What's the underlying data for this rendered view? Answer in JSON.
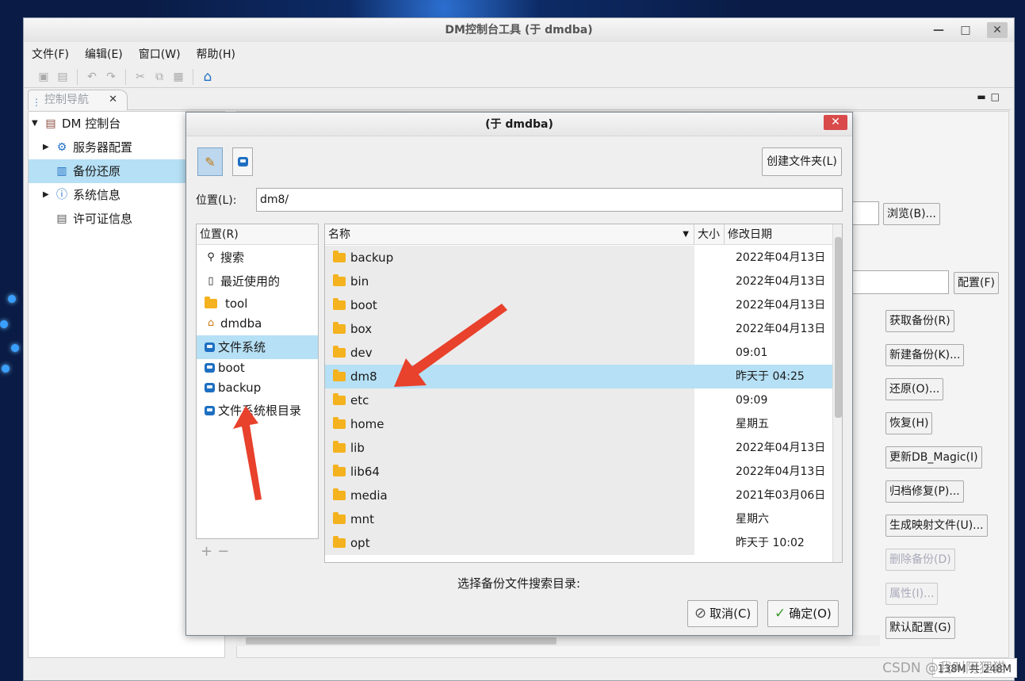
{
  "window": {
    "title": "DM控制台工具 (于 dmdba)",
    "menus": [
      "文件(F)",
      "编辑(E)",
      "窗口(W)",
      "帮助(H)"
    ],
    "tab_label": "控制导航"
  },
  "tree": {
    "root": "DM 控制台",
    "items": [
      "服务器配置",
      "备份还原",
      "系统信息",
      "许可证信息"
    ]
  },
  "right_panel": {
    "browse_btn": "浏览(B)...",
    "config_btn": "配置(F)",
    "buttons": [
      "获取备份(R)",
      "新建备份(K)...",
      "还原(O)...",
      "恢复(H)",
      "更新DB_Magic(I)",
      "归档修复(P)...",
      "生成映射文件(U)...",
      "删除备份(D)",
      "属性(I)...",
      "默认配置(G)"
    ]
  },
  "status": "138M 共 248M",
  "watermark": "CSDN @我叫阿狸猫",
  "dialog": {
    "title": "(于 dmdba)",
    "new_folder": "创建文件夹(L)",
    "location_label": "位置(L):",
    "location_value": "dm8/",
    "places_header": "位置(R)",
    "places": [
      "搜索",
      "最近使用的",
      "tool",
      "dmdba",
      "文件系统",
      "boot",
      "backup",
      "文件系统根目录"
    ],
    "columns": {
      "name": "名称",
      "size": "大小",
      "date": "修改日期"
    },
    "files": [
      {
        "name": "backup",
        "date": "2022年04月13日"
      },
      {
        "name": "bin",
        "date": "2022年04月13日"
      },
      {
        "name": "boot",
        "date": "2022年04月13日"
      },
      {
        "name": "box",
        "date": "2022年04月13日"
      },
      {
        "name": "dev",
        "date": "09:01"
      },
      {
        "name": "dm8",
        "date": "昨天于 04:25"
      },
      {
        "name": "etc",
        "date": "09:09"
      },
      {
        "name": "home",
        "date": "星期五"
      },
      {
        "name": "lib",
        "date": "2022年04月13日"
      },
      {
        "name": "lib64",
        "date": "2022年04月13日"
      },
      {
        "name": "media",
        "date": "2021年03月06日"
      },
      {
        "name": "mnt",
        "date": "星期六"
      },
      {
        "name": "opt",
        "date": "昨天于 10:02"
      }
    ],
    "hint": "选择备份文件搜索目录:",
    "cancel": "取消(C)",
    "ok": "确定(O)"
  },
  "colors": {
    "selection": "#b6e0f5",
    "close_red": "#d94a4a",
    "annotation_arrow": "#e8412c",
    "folder": "#f4b21e"
  }
}
